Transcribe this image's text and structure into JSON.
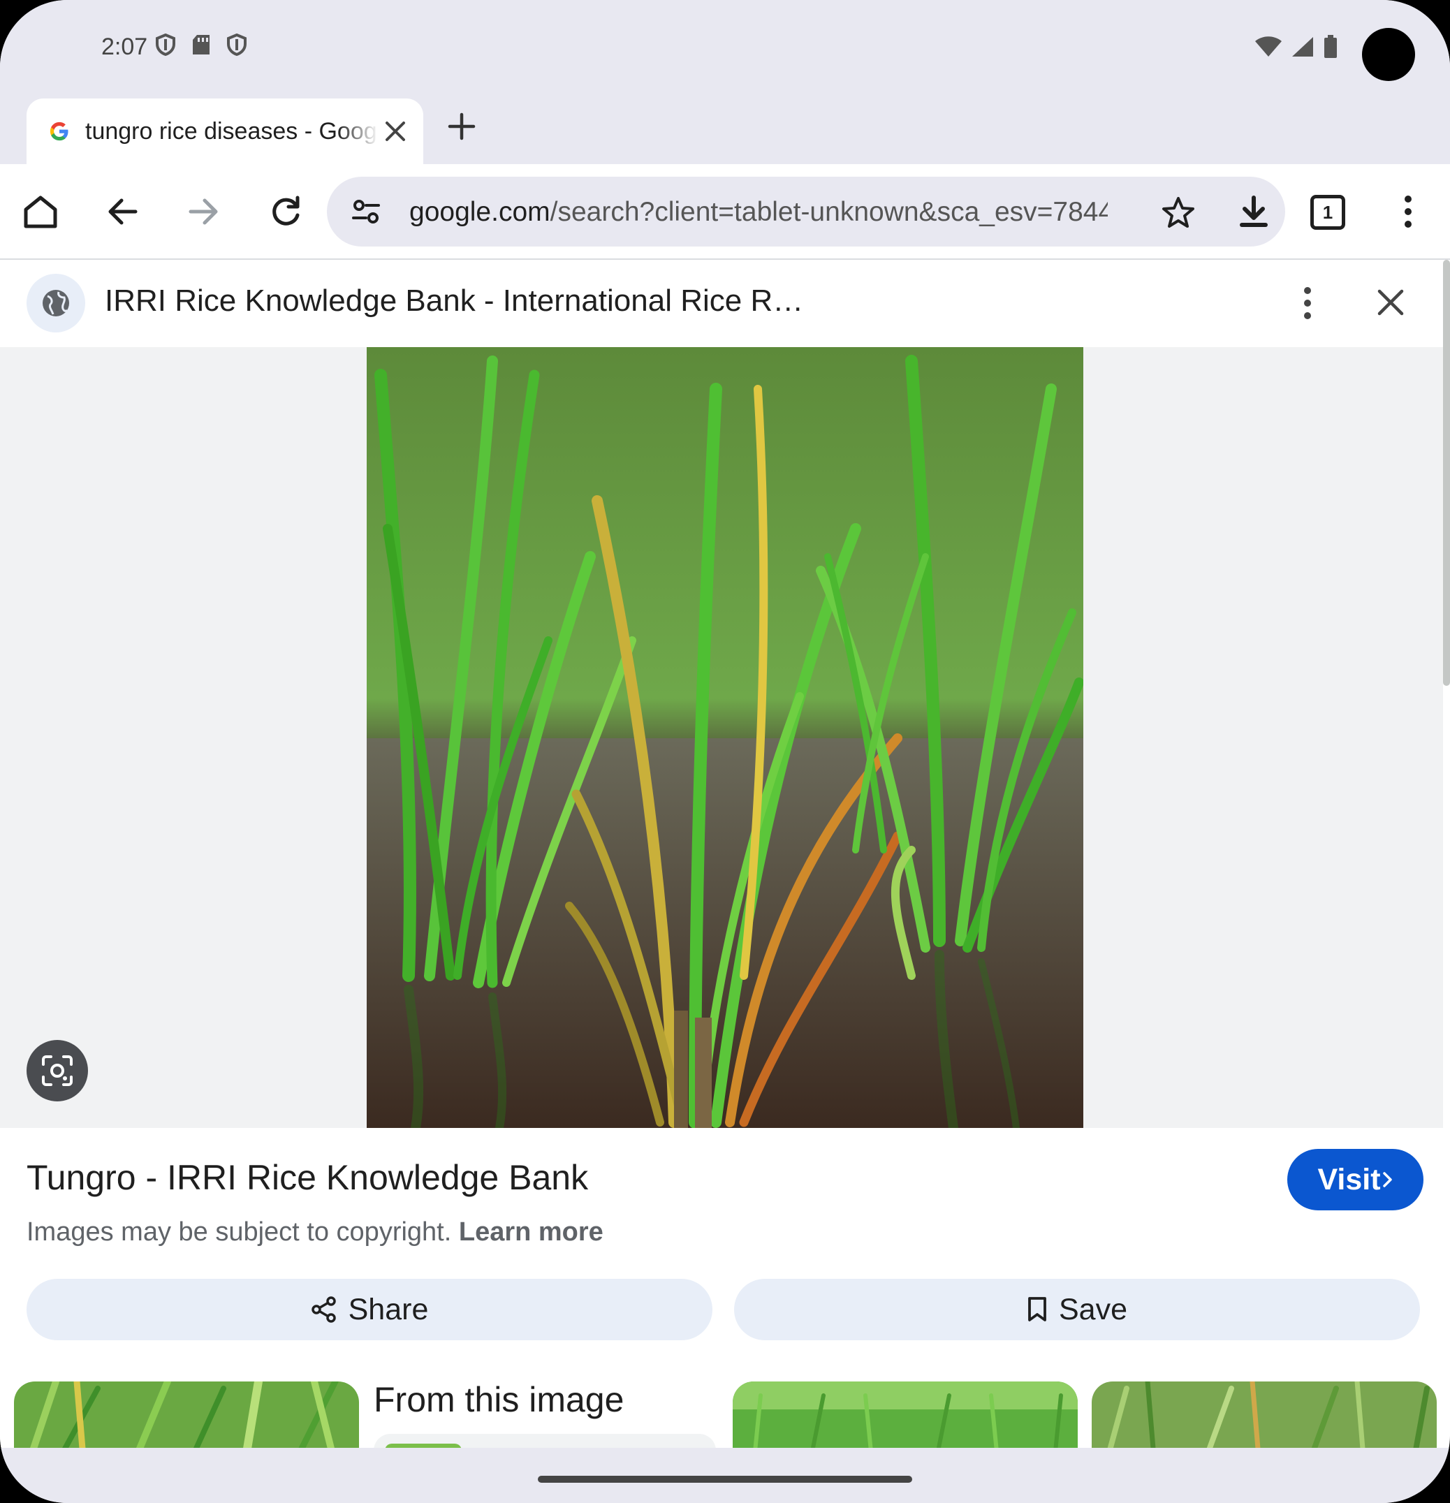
{
  "status_bar": {
    "time": "2:07",
    "left_icons": [
      "vpn-shield-icon",
      "sd-card-icon",
      "vpn-shield-icon"
    ],
    "right_icons": [
      "wifi-icon",
      "signal-icon",
      "battery-icon"
    ]
  },
  "tab": {
    "title": "tungro rice diseases - Google Search",
    "favicon": "google-g-icon"
  },
  "toolbar": {
    "url_host": "google.com",
    "url_rest": "/search?client=tablet-unknown&sca_esv=7844",
    "tab_count": "1"
  },
  "sheet": {
    "site_title": "IRRI Rice Knowledge Bank - International Rice R…"
  },
  "result": {
    "title": "Tungro - IRRI Rice Knowledge Bank",
    "visit_label": "Visit",
    "copyright_text": "Images may be subject to copyright.",
    "learn_more": "Learn more",
    "share_label": "Share",
    "save_label": "Save",
    "from_title": "From this image"
  },
  "colors": {
    "accent": "#0b57d0",
    "chrome_bg": "#e8e8f1",
    "button_bg": "#e8eef8"
  }
}
